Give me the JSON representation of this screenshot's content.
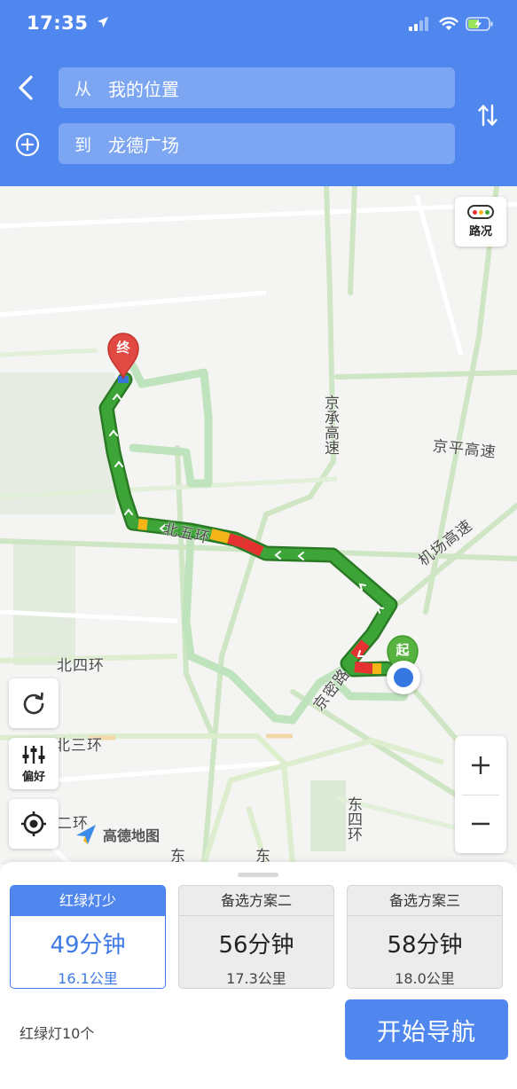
{
  "status_bar": {
    "time": "17:35"
  },
  "search": {
    "from_prefix": "从",
    "from_value": "我的位置",
    "to_prefix": "到",
    "to_value": "龙德广场"
  },
  "map": {
    "traffic_button_label": "路况",
    "preference_button_label": "偏好",
    "start_marker_label": "起",
    "end_marker_label": "终",
    "road_labels": {
      "jingcheng_expressway": "京承高速",
      "jingping_expressway": "京平高速",
      "airport_expressway": "机场高速",
      "north_5th_ring": "北五环",
      "north_4th_ring": "北四环",
      "north_3rd_ring": "北三环",
      "jingmi_road": "京密路",
      "east_4th_ring": "东四环",
      "second_ring": "二环",
      "east_a": "东",
      "east_b": "东"
    },
    "logo_text": "高德地图"
  },
  "routes": [
    {
      "title": "红绿灯少",
      "time": "49分钟",
      "distance": "16.1公里",
      "selected": true
    },
    {
      "title": "备选方案二",
      "time": "56分钟",
      "distance": "17.3公里",
      "selected": false
    },
    {
      "title": "备选方案三",
      "time": "58分钟",
      "distance": "18.0公里",
      "selected": false
    }
  ],
  "traffic_lights_text": "红绿灯10个",
  "start_navigation_label": "开始导航",
  "colors": {
    "brand_blue": "#5087ee",
    "traffic_green": "#3da538",
    "traffic_red": "#e53230",
    "traffic_yellow": "#f5b418"
  }
}
